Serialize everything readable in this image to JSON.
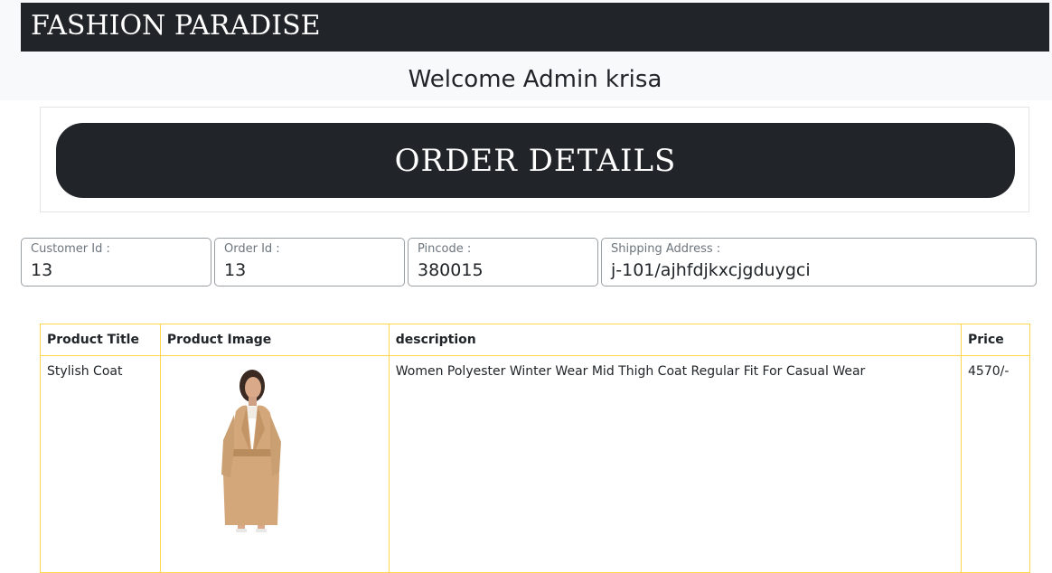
{
  "navbar": {
    "brand": "FASHION PARADISE"
  },
  "welcome": "Welcome Admin krisa",
  "page_heading": "ORDER DETAILS",
  "order": {
    "customer_id": {
      "label": "Customer Id :",
      "value": "13"
    },
    "order_id": {
      "label": "Order Id :",
      "value": "13"
    },
    "pincode": {
      "label": "Pincode :",
      "value": "380015"
    },
    "shipping_address": {
      "label": "Shipping Address :",
      "value": "j-101/ajhfdjkxcjgduygci"
    }
  },
  "table": {
    "headers": [
      "Product Title",
      "Product Image",
      "description",
      "Price"
    ],
    "rows": [
      {
        "title": "Stylish Coat",
        "image_icon": "coat-product-photo",
        "description": "Women Polyester Winter Wear Mid Thigh Coat Regular Fit For Casual Wear",
        "price": "4570/-"
      }
    ]
  },
  "colors": {
    "dark": "#212529",
    "light_bg": "#f8f9fa",
    "table_border": "#ffd54f"
  }
}
